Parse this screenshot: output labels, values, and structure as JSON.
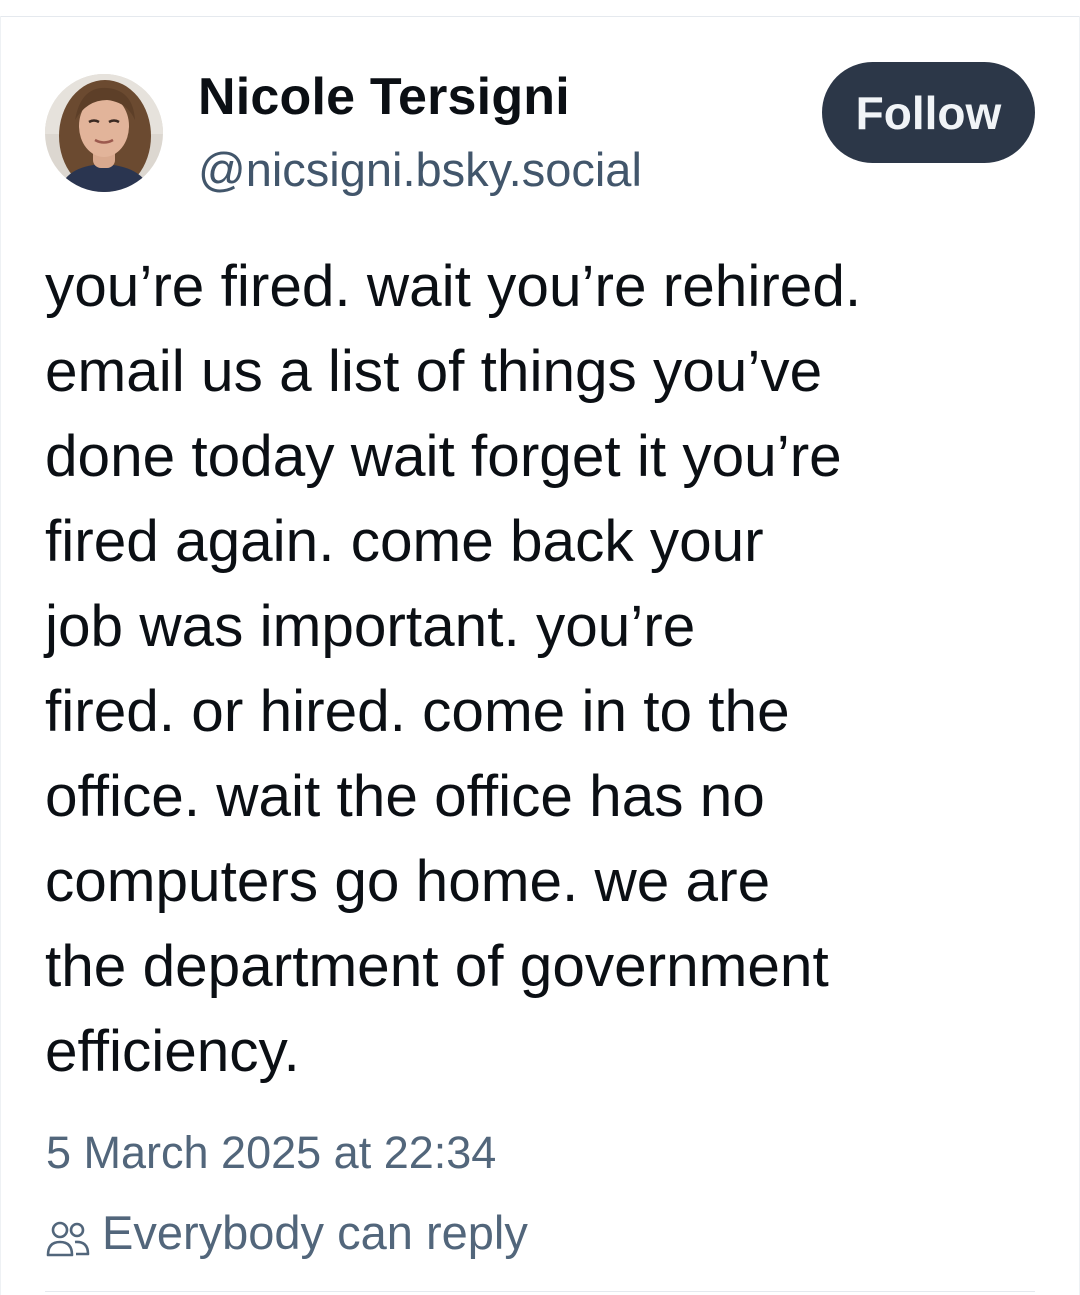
{
  "post": {
    "author": {
      "display_name": "Nicole Tersigni",
      "handle": "@nicsigni.bsky.social",
      "avatar_icon": "profile-photo"
    },
    "follow_label": "Follow",
    "text_lines": [
      "you’re fired. wait you’re rehired.",
      "email us a list of things you’ve",
      "done today wait forget it you’re",
      "fired again. come back your",
      "job was important. you’re",
      "fired. or hired. come in to the",
      "office. wait the office has no",
      "computers go home. we are",
      "the department of government",
      "efficiency."
    ],
    "timestamp": "5 March 2025 at 22:34",
    "reply_setting": {
      "icon": "people-icon",
      "label": "Everybody can reply"
    }
  },
  "colors": {
    "follow_button_bg": "#2c3748",
    "muted_text": "#52667b",
    "handle_text": "#42566b",
    "body_text": "#0b0f14"
  }
}
